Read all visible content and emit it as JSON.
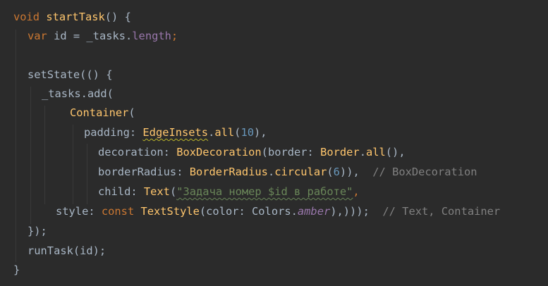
{
  "code": {
    "l1": {
      "kw": "void",
      "fn": "startTask",
      "rest": "() {"
    },
    "l2": {
      "kw": "var",
      "ident": " id = _tasks.",
      "prop": "length",
      "semi": ";"
    },
    "l4": {
      "text": "setState(() {"
    },
    "l5": {
      "text": "_tasks.add("
    },
    "l6": {
      "fn": "Container",
      "rest": "("
    },
    "l7": {
      "label": "padding: ",
      "fn1": "EdgeInsets",
      "dot": ".",
      "fn2": "all",
      "open": "(",
      "num": "10",
      "close": "),"
    },
    "l8": {
      "label": "decoration: ",
      "fn1": "BoxDecoration",
      "mid": "(border: ",
      "fn2": "Border",
      "dot": ".",
      "fn3": "all",
      "rest": "(),"
    },
    "l9": {
      "label": "borderRadius: ",
      "fn1": "BorderRadius",
      "dot": ".",
      "fn2": "circular",
      "open": "(",
      "num": "6",
      "close": ")),",
      "comment": "  // BoxDecoration"
    },
    "l10": {
      "label": "child: ",
      "fn": "Text",
      "open": "(",
      "str": "\"Задача номер $id в работе\"",
      "close": ","
    },
    "l11": {
      "label": "style: ",
      "kw": "const ",
      "fn": "TextStyle",
      "mid": "(color: Colors.",
      "prop": "amber",
      "close": "),)));",
      "comment": "  // Text, Container"
    },
    "l12": {
      "text": "});"
    },
    "l13": {
      "text": "runTask(id);"
    },
    "l14": {
      "text": "}"
    }
  }
}
